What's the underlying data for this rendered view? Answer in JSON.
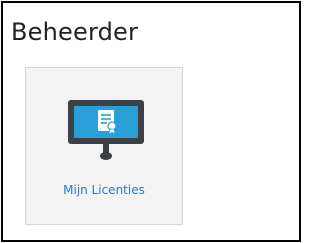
{
  "page": {
    "title": "Beheerder"
  },
  "tiles": [
    {
      "label": "Mijn Licenties",
      "icon": "monitor-certificate-icon",
      "colors": {
        "screen": "#2a9fd8",
        "bezel": "#3b3f46",
        "label": "#2f78c4"
      }
    }
  ]
}
